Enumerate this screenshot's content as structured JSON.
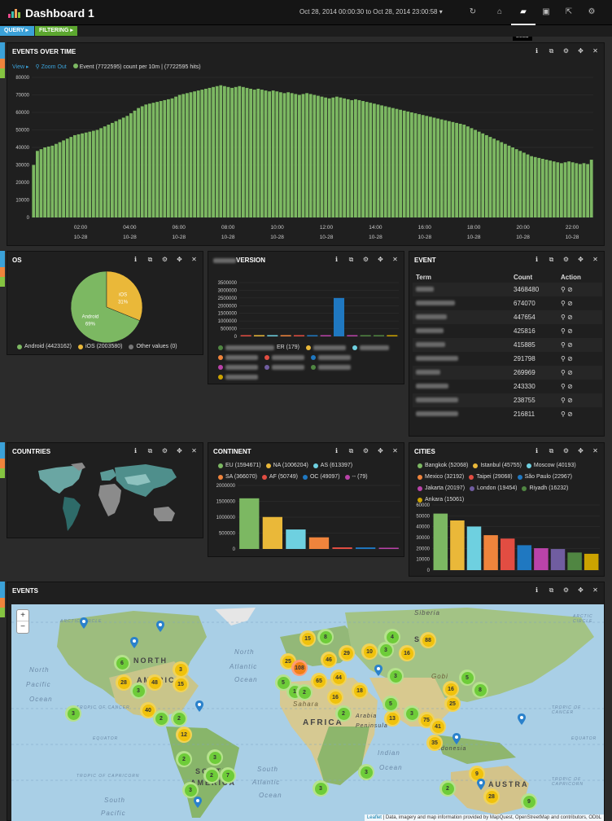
{
  "app": {
    "title": "Dashboard 1",
    "time_range": "Oct 28, 2014 00:00:30 to Oct 28, 2014 23:00:58",
    "tooltip": "Load"
  },
  "nav_icons": [
    "refresh-icon",
    "home-icon",
    "folder-icon",
    "save-icon",
    "share-icon",
    "gear-icon"
  ],
  "filters": {
    "query": "QUERY",
    "filtering": "FILTERING"
  },
  "events_over_time": {
    "title": "EVENTS OVER TIME",
    "view_label": "View",
    "zoom_out_label": "Zoom Out",
    "legend": "Event (7722595)  count per 10m | (7722595 hits)",
    "chart_data": {
      "type": "bar",
      "ylim": [
        0,
        80000
      ],
      "yticks": [
        "80000",
        "70000",
        "60000",
        "50000",
        "40000",
        "30000",
        "20000",
        "10000",
        "0"
      ],
      "xticks": [
        "02:00",
        "04:00",
        "06:00",
        "08:00",
        "10:00",
        "12:00",
        "14:00",
        "16:00",
        "18:00",
        "20:00",
        "22:00"
      ],
      "xtick_sub": "10-28",
      "values": [
        30000,
        38000,
        39000,
        40000,
        40500,
        41000,
        42000,
        43000,
        44000,
        45000,
        46000,
        47000,
        47500,
        48000,
        48500,
        49000,
        49500,
        50000,
        51000,
        52000,
        53000,
        54000,
        55000,
        56000,
        57000,
        58000,
        59500,
        61000,
        62500,
        63500,
        64500,
        65000,
        65500,
        66000,
        66500,
        67000,
        67500,
        68000,
        69000,
        70000,
        70500,
        71000,
        71500,
        72000,
        72500,
        73000,
        73500,
        74000,
        74500,
        75000,
        75500,
        75000,
        74500,
        74000,
        74500,
        75000,
        74500,
        74000,
        73500,
        73000,
        73500,
        73000,
        72500,
        72000,
        72500,
        72000,
        71500,
        71000,
        71500,
        71000,
        70500,
        70000,
        70500,
        71000,
        70500,
        70000,
        69500,
        69000,
        68500,
        68000,
        68500,
        69000,
        68500,
        68000,
        67500,
        67000,
        67500,
        67000,
        66500,
        66000,
        65500,
        65000,
        64500,
        64000,
        63500,
        63000,
        62500,
        62000,
        61500,
        61000,
        60500,
        60000,
        59500,
        59000,
        58500,
        58000,
        57500,
        57000,
        56500,
        56000,
        55500,
        55000,
        54500,
        54000,
        53500,
        53000,
        52000,
        51000,
        50000,
        49000,
        48000,
        47000,
        46000,
        45000,
        44000,
        43000,
        42000,
        41000,
        40000,
        39000,
        38000,
        37000,
        36000,
        35000,
        34500,
        34000,
        33500,
        33000,
        32500,
        32000,
        31500,
        31000,
        31500,
        32000,
        31500,
        31000,
        30500,
        31000,
        30500,
        33000
      ]
    }
  },
  "os": {
    "title": "OS",
    "chart_data": {
      "type": "pie",
      "slices": [
        {
          "label": "Android",
          "value": 4423162,
          "pct": "69%",
          "color": "#7cb862"
        },
        {
          "label": "iOS",
          "value": 2003580,
          "pct": "31%",
          "color": "#eab839"
        }
      ]
    },
    "legend": [
      "Android (4423162)",
      "iOS (2003580)",
      "Other values (0)"
    ]
  },
  "version": {
    "title": "VERSION",
    "chart_data": {
      "type": "bar",
      "ylim": [
        0,
        3500000
      ],
      "yticks": [
        "3500000",
        "3000000",
        "2500000",
        "2000000",
        "1500000",
        "1000000",
        "500000",
        "0"
      ],
      "values": [
        20000,
        15000,
        10000,
        30000,
        15000,
        25000,
        10000,
        2500000,
        30000,
        8000,
        40000,
        20000
      ],
      "colors": [
        "#e24d42",
        "#eab839",
        "#6ed0e0",
        "#ef843c",
        "#e24d42",
        "#1f78c1",
        "#ba43a9",
        "#1f78c1",
        "#ba43a9",
        "#508642",
        "#508642",
        "#cca300"
      ]
    },
    "legend_suffix": "ER (179)"
  },
  "event_table": {
    "title": "EVENT",
    "headers": {
      "term": "Term",
      "count": "Count",
      "action": "Action"
    },
    "counts": [
      "3468480",
      "674070",
      "447654",
      "425816",
      "415885",
      "291798",
      "269969",
      "243330",
      "238755",
      "216811"
    ],
    "action_glyphs": "🔍 ⊘"
  },
  "countries": {
    "title": "COUNTRIES"
  },
  "continent": {
    "title": "CONTINENT",
    "legend": [
      {
        "label": "EU (1594671)",
        "color": "#7cb862"
      },
      {
        "label": "NA (1006204)",
        "color": "#eab839"
      },
      {
        "label": "AS (613397)",
        "color": "#6ed0e0"
      },
      {
        "label": "SA (366070)",
        "color": "#ef843c"
      },
      {
        "label": "AF (50749)",
        "color": "#e24d42"
      },
      {
        "label": "OC (49097)",
        "color": "#1f78c1"
      },
      {
        "label": "-- (79)",
        "color": "#ba43a9"
      }
    ],
    "chart_data": {
      "type": "bar",
      "ylim": [
        0,
        2000000
      ],
      "yticks": [
        "2000000",
        "1500000",
        "1000000",
        "500000",
        "0"
      ],
      "categories": [
        "EU",
        "NA",
        "AS",
        "SA",
        "AF",
        "OC",
        "--"
      ],
      "values": [
        1594671,
        1006204,
        613397,
        366070,
        50749,
        49097,
        79
      ]
    }
  },
  "cities": {
    "title": "CITIES",
    "legend": [
      {
        "label": "Bangkok (52068)",
        "color": "#7cb862"
      },
      {
        "label": "Istanbul (45755)",
        "color": "#eab839"
      },
      {
        "label": "Moscow (40193)",
        "color": "#6ed0e0"
      },
      {
        "label": "Mexico (32192)",
        "color": "#ef843c"
      },
      {
        "label": "Taipei (29068)",
        "color": "#e24d42"
      },
      {
        "label": "São Paulo (22967)",
        "color": "#1f78c1"
      },
      {
        "label": "Jakarta (20197)",
        "color": "#ba43a9"
      },
      {
        "label": "London (19454)",
        "color": "#705da0"
      },
      {
        "label": "Riyadh (16232)",
        "color": "#508642"
      },
      {
        "label": "Ankara (15061)",
        "color": "#cca300"
      }
    ],
    "chart_data": {
      "type": "bar",
      "ylim": [
        0,
        60000
      ],
      "yticks": [
        "60000",
        "50000",
        "40000",
        "30000",
        "20000",
        "10000",
        "0"
      ],
      "categories": [
        "Bangkok",
        "Istanbul",
        "Moscow",
        "Mexico",
        "Taipei",
        "São Paulo",
        "Jakarta",
        "London",
        "Riyadh",
        "Ankara"
      ],
      "values": [
        52068,
        45755,
        40193,
        32192,
        29068,
        22967,
        20197,
        19454,
        16232,
        15061
      ]
    }
  },
  "events_map": {
    "title": "EVENTS",
    "zoom_in": "+",
    "zoom_out": "−",
    "attribution_link": "Leaflet",
    "attribution": " | Data, imagery and map information provided by MapQuest, OpenStreetMap and contributors, ODbL",
    "labels": {
      "africa": "AFRICA",
      "north": "NORTH",
      "america": "AMERICA",
      "south": "SOUTH",
      "siberia": "Siberia",
      "sahara": "Sahara",
      "gobi": "Gobi",
      "north_atlantic": "North",
      "atlantic_ocean": "Ocean",
      "north_pacific": "North",
      "pacific": "Pacific",
      "pacific_ocean": "Ocean",
      "indian": "Indian",
      "indian_ocean": "Ocean",
      "south_atlantic": "South",
      "atlantic2": "Atlantic",
      "ocean2": "Ocean",
      "south_pacific": "South",
      "pacific2": "Pacific",
      "arctic_circle": "ARCTIC CIRCLE",
      "arctic_circle2": "ARCTIC CIRCLE",
      "tropic_cancer": "TROPIC OF CANCER",
      "tropic_cancer2": "TROPIC OF CANCER",
      "equator": "EQUATOR",
      "equator2": "EQUATOR",
      "tropic_capricorn": "TROPIC OF CAPRICORN",
      "tropic_capricorn2": "TROPIC OF CAPRICORN",
      "arabia": "Arabia",
      "peninsula": "Peninsula",
      "asia": "SIA",
      "indonesia": "Indonesia",
      "australia": "AUSTRA",
      "north_atlantic2": "Atlantic"
    },
    "clusters": [
      "6",
      "28",
      "48",
      "15",
      "3",
      "2",
      "3",
      "40",
      "2",
      "12",
      "2",
      "3",
      "3",
      "2",
      "7",
      "3",
      "1",
      "15",
      "8",
      "25",
      "108",
      "46",
      "29",
      "10",
      "65",
      "44",
      "5",
      "16",
      "18",
      "4",
      "3",
      "16",
      "88",
      "3",
      "2",
      "8",
      "16",
      "25",
      "2",
      "13",
      "5",
      "3",
      "75",
      "41",
      "35",
      "3",
      "3",
      "2",
      "9",
      "28",
      "9",
      "5"
    ]
  }
}
